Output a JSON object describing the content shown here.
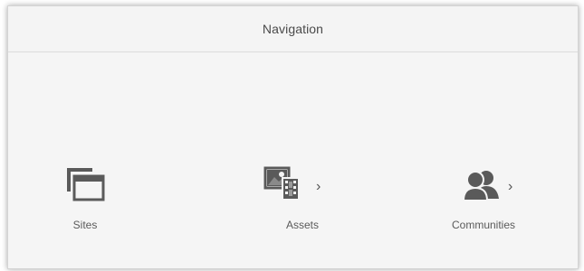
{
  "header": {
    "title": "Navigation"
  },
  "nav": {
    "items": [
      {
        "label": "Sites",
        "icon": "sites-icon",
        "has_submenu": false
      },
      {
        "label": "Assets",
        "icon": "assets-icon",
        "has_submenu": true
      },
      {
        "label": "Communities",
        "icon": "communities-icon",
        "has_submenu": true
      }
    ]
  },
  "icons": {
    "chevron": "›"
  },
  "colors": {
    "icon": "#5a5a5a",
    "panel_bg": "#f5f5f5",
    "text": "#4a4a4a"
  }
}
